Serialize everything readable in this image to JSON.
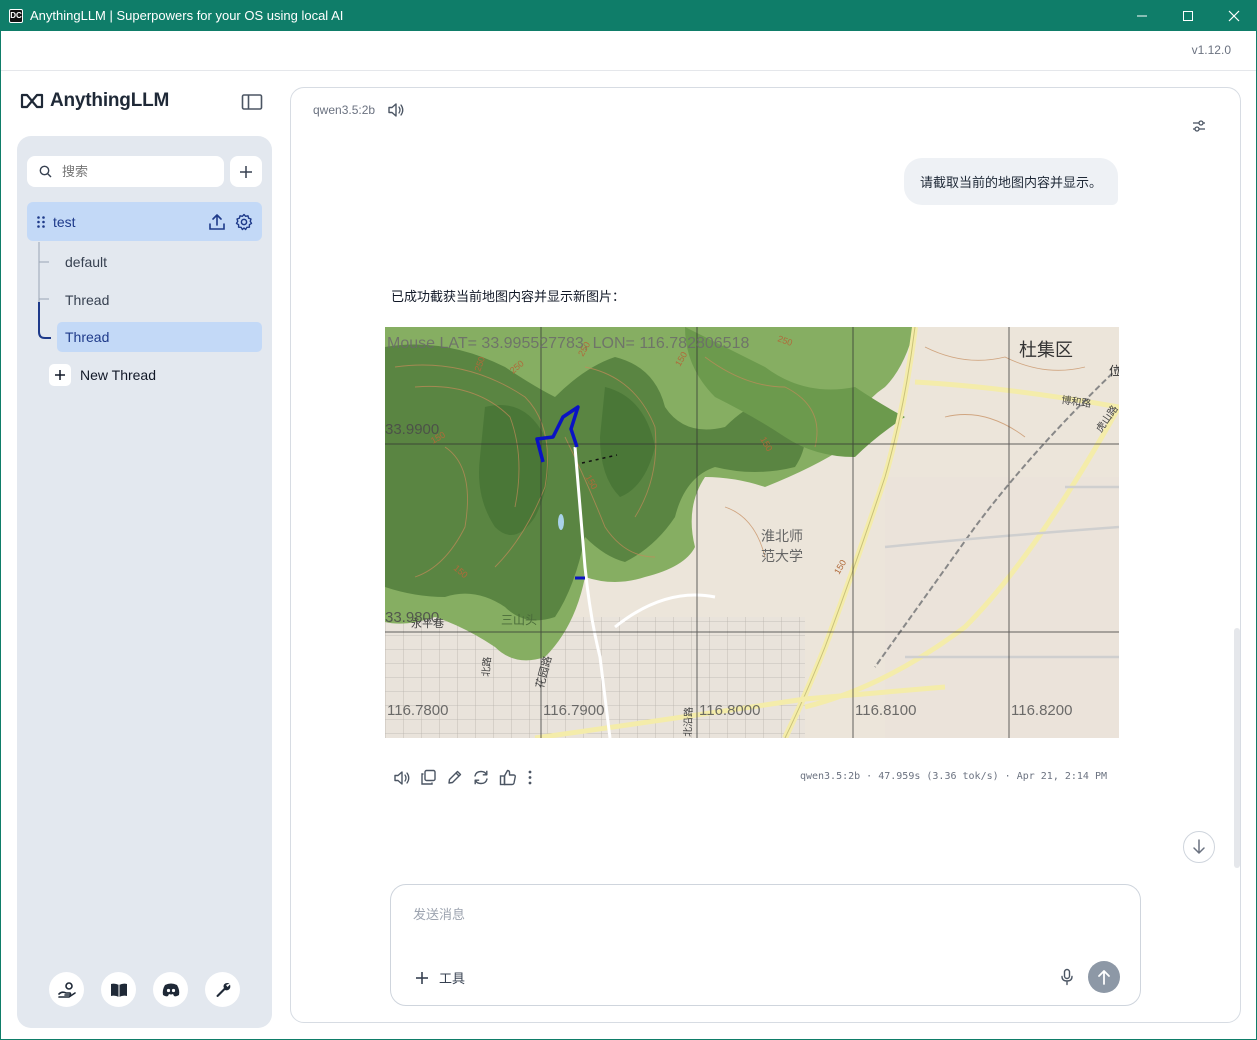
{
  "window": {
    "title": "AnythingLLM | Superpowers for your OS using local AI",
    "app_icon_text": "DC"
  },
  "version": "v1.12.0",
  "brand": {
    "name": "AnythingLLM"
  },
  "sidebar": {
    "search_placeholder": "搜索",
    "workspace": {
      "name": "test"
    },
    "threads": [
      {
        "label": "default",
        "active": false
      },
      {
        "label": "Thread",
        "active": false
      },
      {
        "label": "Thread",
        "active": true
      }
    ],
    "new_thread_label": "New Thread"
  },
  "chat": {
    "model": "qwen3.5:2b",
    "user_message": "请截取当前的地图内容并显示。",
    "assistant_message": "已成功截获当前地图内容并显示新图片：",
    "map": {
      "mouse_readout": "Mouse LAT= 33.995527783, LON= 116.782806518",
      "lat_labels": [
        "33.9900",
        "33.9800"
      ],
      "lon_labels": [
        "116.7800",
        "116.7900",
        "116.8000",
        "116.8100",
        "116.8200"
      ],
      "place_labels": {
        "district": "杜集区",
        "university_line1": "淮北师",
        "university_line2": "范大学",
        "village": "三山头",
        "alley": "永平巷",
        "road1": "博和路",
        "road2": "花园路",
        "road3": "北沿路",
        "road4": "虎山路",
        "road5": "北路",
        "cut_label": "位"
      },
      "contours": [
        "250",
        "250",
        "150",
        "250",
        "150",
        "150",
        "150",
        "150",
        "250",
        "150"
      ],
      "colors": {
        "forest_dark": "#4f7b3c",
        "forest_light": "#7ea95a",
        "land": "#ece5da",
        "road_major": "#f6f0a8",
        "contour": "#c58a5a",
        "route": "#0a12c4",
        "grid": "#333333"
      }
    },
    "meta": "qwen3.5:2b · 47.959s (3.36 tok/s) · Apr 21, 2:14 PM",
    "input_placeholder": "发送消息",
    "tools_label": "工具"
  },
  "colors": {
    "titlebar": "#0f7d69",
    "sidebar_bg": "#e3e8ef",
    "active_item": "#c3d9f7",
    "accent_text": "#1e3a8a"
  }
}
